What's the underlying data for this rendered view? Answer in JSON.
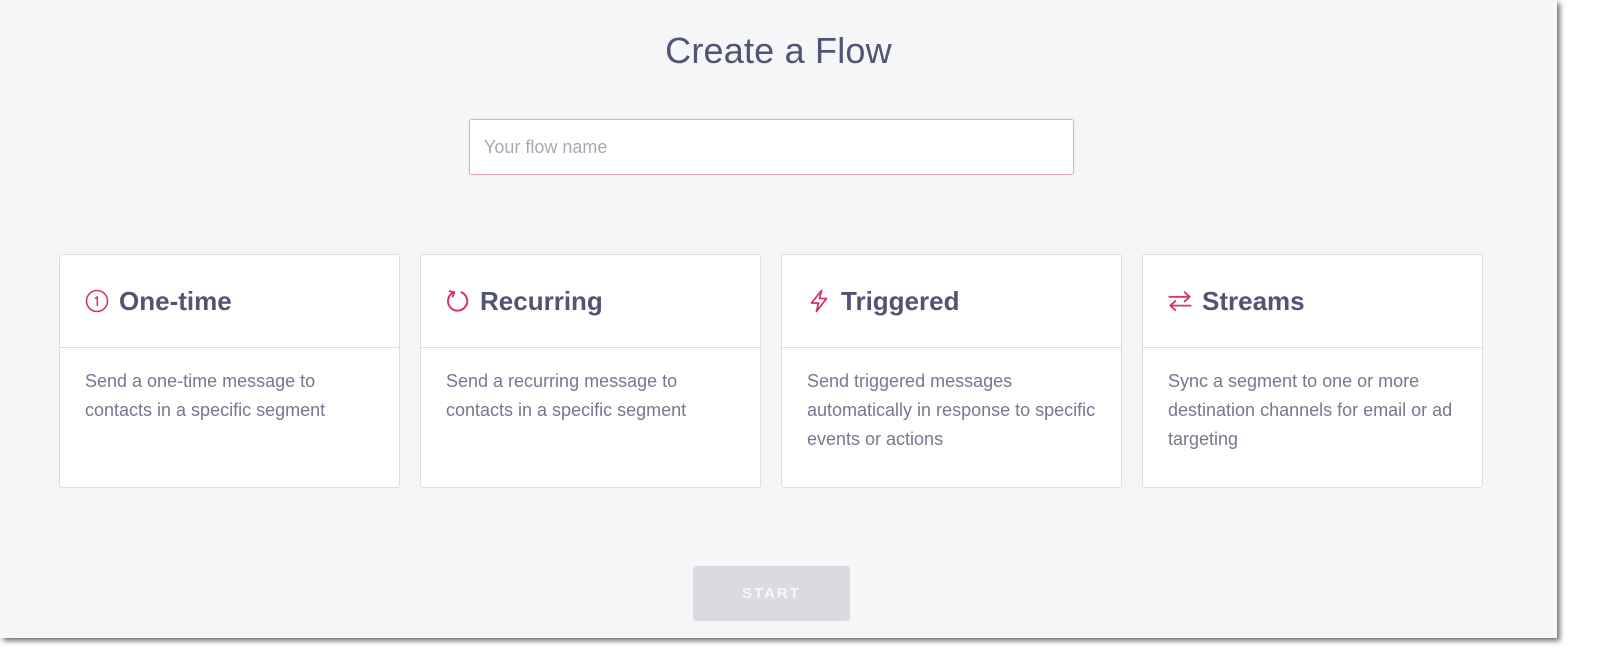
{
  "page": {
    "title": "Create a Flow"
  },
  "flow_name_input": {
    "placeholder": "Your flow name",
    "value": ""
  },
  "flow_types": [
    {
      "id": "one-time",
      "icon": "one-time-icon",
      "title": "One-time",
      "description": "Send a one-time message to contacts in a specific segment"
    },
    {
      "id": "recurring",
      "icon": "recurring-icon",
      "title": "Recurring",
      "description": "Send a recurring message to contacts in a specific segment"
    },
    {
      "id": "triggered",
      "icon": "lightning-bolt-icon",
      "title": "Triggered",
      "description": "Send triggered messages automatically in response to specific events or actions"
    },
    {
      "id": "streams",
      "icon": "exchange-arrows-icon",
      "title": "Streams",
      "description": "Sync a segment to one or more destination channels for email or ad targeting"
    }
  ],
  "actions": {
    "start_label": "START",
    "start_enabled": false
  },
  "colors": {
    "accent": "#d6336c",
    "heading": "#525375",
    "body_text": "#757890",
    "background": "#f5f6f8",
    "card_border": "#dcdee4",
    "disabled_button": "#d9dbe0"
  }
}
